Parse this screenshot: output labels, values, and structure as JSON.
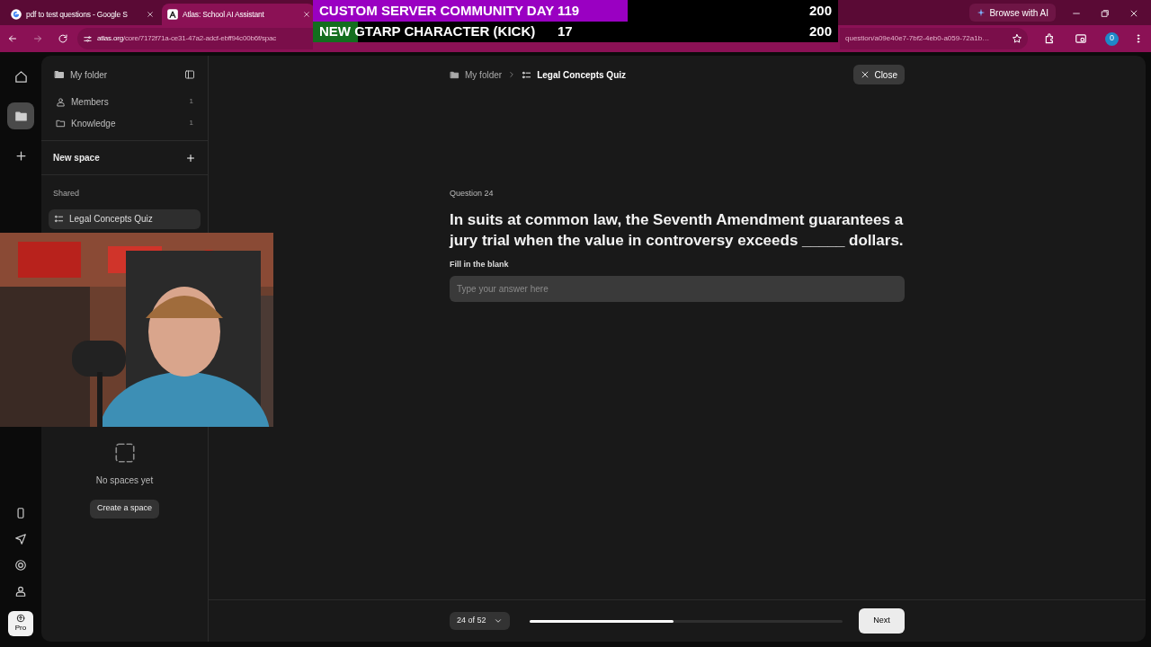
{
  "browser": {
    "tabs": [
      {
        "title": "pdf to test questions - Google S",
        "selected": false,
        "kind": "google"
      },
      {
        "title": "Atlas: School AI Assistant",
        "selected": true,
        "kind": "atlas"
      }
    ],
    "url_host": "atlas.org",
    "url_path_start": "/core/7172f71a-ce31-47a2-adcf-ebff94c00b6f/spac",
    "url_path_end": "question/a09e40e7-7bf2-4eb0-a059-72a1b…",
    "browse_ai": "Browse with AI",
    "profile": "0"
  },
  "stream_overlay": {
    "goals": [
      {
        "label": "CUSTOM SERVER COMMUNITY DAY",
        "count": "119",
        "target": "200",
        "level": 0.6,
        "color": "#9a00c2"
      },
      {
        "label": "NEW GTARP CHARACTER (KICK)",
        "count": "17",
        "target": "200",
        "level": 0.085,
        "color": "#136e1e"
      }
    ]
  },
  "rail": {
    "top_items": [
      {
        "kind": "home",
        "selected": false
      },
      {
        "kind": "folder",
        "selected": true
      },
      {
        "kind": "add",
        "selected": false
      }
    ],
    "bottom_items": [
      {
        "kind": "phone"
      },
      {
        "kind": "send"
      },
      {
        "kind": "help"
      },
      {
        "kind": "user"
      }
    ],
    "pro_label": "Pro"
  },
  "sidebar": {
    "title": "My folder",
    "items": [
      {
        "label": "Members",
        "count": "1",
        "kind": "members"
      },
      {
        "label": "Knowledge",
        "count": "1",
        "kind": "knowledge"
      }
    ],
    "new_space": "New space",
    "shared_heading": "Shared",
    "shared_items": [
      {
        "label": "Legal Concepts Quiz",
        "selected": true
      }
    ],
    "empty_text": "No spaces yet",
    "create_button": "Create a space"
  },
  "breadcrumb": [
    {
      "label": "My folder",
      "kind": "folder"
    },
    {
      "label": "Legal Concepts Quiz",
      "kind": "quiz"
    }
  ],
  "close_button": "Close",
  "question": {
    "number": "Question 24",
    "text": "In suits at common law, the Seventh Amendment guarantees a jury trial when the value in controversy exceeds _____ dollars.",
    "answer_label": "Fill in the blank",
    "placeholder": "Type your answer here"
  },
  "footer": {
    "position": "24 of 52",
    "level": 0.46,
    "next": "Next"
  }
}
